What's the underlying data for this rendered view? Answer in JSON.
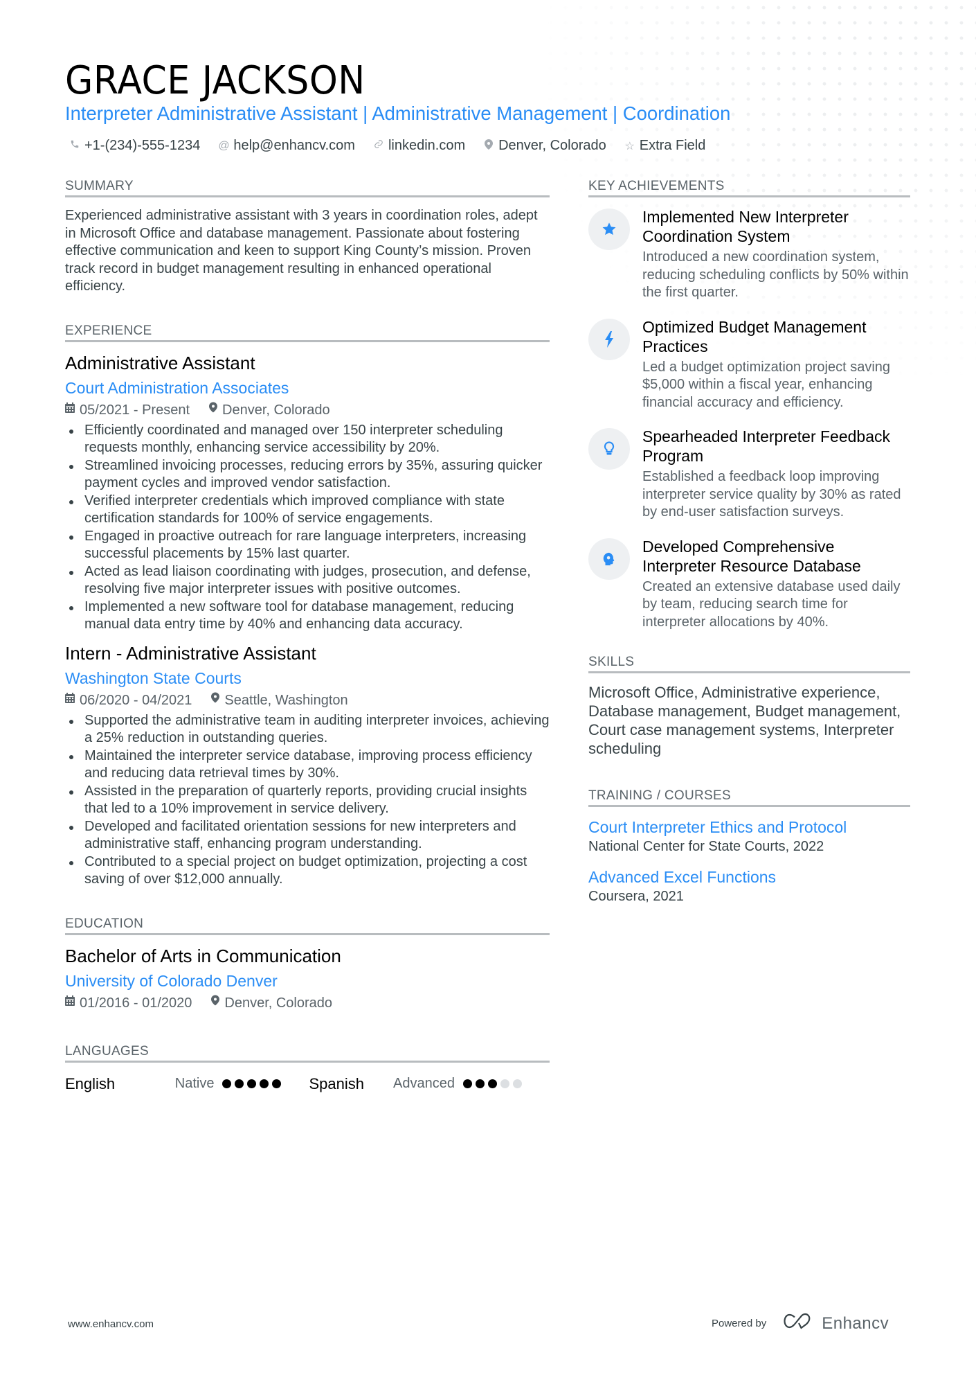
{
  "header": {
    "name": "GRACE JACKSON",
    "headline": "Interpreter Administrative Assistant | Administrative Management | Coordination",
    "contacts": [
      {
        "icon": "phone-icon",
        "glyph": "✆",
        "text": "+1-(234)-555-1234"
      },
      {
        "icon": "at-icon",
        "glyph": "@",
        "text": "help@enhancv.com"
      },
      {
        "icon": "link-icon",
        "glyph": "🔗︎",
        "text": "linkedin.com"
      },
      {
        "icon": "location-pin-icon",
        "glyph": "⚲",
        "text": "Denver, Colorado"
      },
      {
        "icon": "star-outline-icon",
        "glyph": "☆",
        "text": "Extra Field"
      }
    ]
  },
  "summary": {
    "title": "SUMMARY",
    "text": "Experienced administrative assistant with 3 years in coordination roles, adept in Microsoft Office and database management. Passionate about fostering effective communication and keen to support King County’s mission. Proven track record in budget management resulting in enhanced operational efficiency."
  },
  "experience": {
    "title": "EXPERIENCE",
    "jobs": [
      {
        "title": "Administrative Assistant",
        "company": "Court Administration Associates",
        "dates": "05/2021 - Present",
        "location": "Denver, Colorado",
        "bullets": [
          "Efficiently coordinated and managed over 150 interpreter scheduling requests monthly, enhancing service accessibility by 20%.",
          "Streamlined invoicing processes, reducing errors by 35%, assuring quicker payment cycles and improved vendor satisfaction.",
          "Verified interpreter credentials which improved compliance with state certification standards for 100% of service engagements.",
          "Engaged in proactive outreach for rare language interpreters, increasing successful placements by 15% last quarter.",
          "Acted as lead liaison coordinating with judges, prosecution, and defense, resolving five major interpreter issues with positive outcomes.",
          "Implemented a new software tool for database management, reducing manual data entry time by 40% and enhancing data accuracy."
        ]
      },
      {
        "title": "Intern - Administrative Assistant",
        "company": "Washington State Courts",
        "dates": "06/2020 - 04/2021",
        "location": "Seattle, Washington",
        "bullets": [
          "Supported the administrative team in auditing interpreter invoices, achieving a 25% reduction in outstanding queries.",
          "Maintained the interpreter service database, improving process efficiency and reducing data retrieval times by 30%.",
          "Assisted in the preparation of quarterly reports, providing crucial insights that led to a 10% improvement in service delivery.",
          "Developed and facilitated orientation sessions for new interpreters and administrative staff, enhancing program understanding.",
          "Contributed to a special project on budget optimization, projecting a cost saving of over $12,000 annually."
        ]
      }
    ]
  },
  "education": {
    "title": "EDUCATION",
    "degree": "Bachelor of Arts in Communication",
    "school": "University of Colorado Denver",
    "dates": "01/2016 - 01/2020",
    "location": "Denver, Colorado"
  },
  "languages": {
    "title": "LANGUAGES",
    "items": [
      {
        "name": "English",
        "level": "Native",
        "rating": 5,
        "max": 5
      },
      {
        "name": "Spanish",
        "level": "Advanced",
        "rating": 3,
        "max": 5
      }
    ]
  },
  "achievements": {
    "title": "KEY ACHIEVEMENTS",
    "items": [
      {
        "icon": "star-icon",
        "title": "Implemented New Interpreter Coordination System",
        "desc": "Introduced a new coordination system, reducing scheduling conflicts by 50% within the first quarter."
      },
      {
        "icon": "lightning-bolt-icon",
        "title": "Optimized Budget Management Practices",
        "desc": "Led a budget optimization project saving $5,000 within a fiscal year, enhancing financial accuracy and efficiency."
      },
      {
        "icon": "lightbulb-icon",
        "title": "Spearheaded Interpreter Feedback Program",
        "desc": "Established a feedback loop improving interpreter service quality by 30% as rated by end-user satisfaction surveys."
      },
      {
        "icon": "brain-head-icon",
        "title": "Developed Comprehensive Interpreter Resource Database",
        "desc": "Created an extensive database used daily by team, reducing search time for interpreter allocations by 40%."
      }
    ]
  },
  "skills": {
    "title": "SKILLS",
    "text": "Microsoft Office, Administrative experience, Database management, Budget management, Court case management systems, Interpreter scheduling"
  },
  "training": {
    "title": "TRAINING / COURSES",
    "items": [
      {
        "title": "Court Interpreter Ethics and Protocol",
        "sub": "National Center for State Courts, 2022"
      },
      {
        "title": "Advanced Excel Functions",
        "sub": "Coursera, 2021"
      }
    ]
  },
  "footer": {
    "website": "www.enhancv.com",
    "powered_by": "Powered by",
    "brand": "Enhancv"
  },
  "colors": {
    "accent": "#2a8df5",
    "text": "#384347",
    "heading": "#000000"
  }
}
